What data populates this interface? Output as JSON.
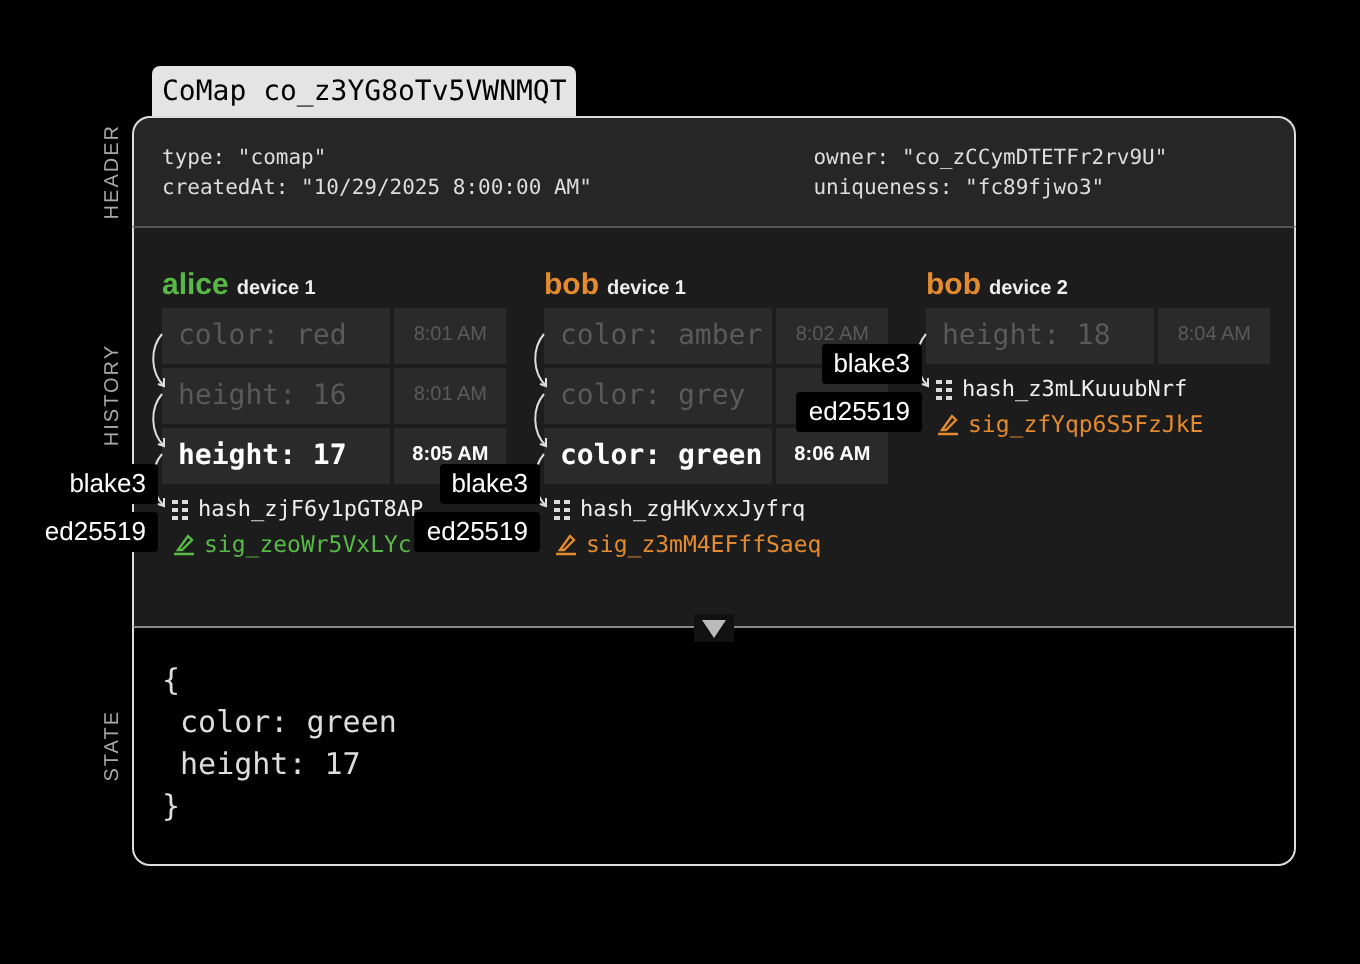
{
  "title": "CoMap co_z3YG8oTv5VWNMQT",
  "header": {
    "label": "HEADER",
    "left": [
      "type: \"comap\"",
      "createdAt: \"10/29/2025 8:00:00 AM\""
    ],
    "right": [
      "owner: \"co_zCCymDTETFr2rv9U\"",
      "uniqueness: \"fc89fjwo3\""
    ]
  },
  "history": {
    "label": "HISTORY",
    "columns": [
      {
        "user": "alice",
        "device": "device 1",
        "color": "#58b947",
        "entries": [
          {
            "text": "color: red",
            "time": "8:01 AM",
            "current": false
          },
          {
            "text": "height: 16",
            "time": "8:01 AM",
            "current": false
          },
          {
            "text": "height: 17",
            "time": "8:05 AM",
            "current": true
          }
        ],
        "hash": "hash_zjF6y1pGT8AP",
        "signature": "sig_zeoWr5VxLYc",
        "hash_algo": "blake3",
        "sig_algo": "ed25519"
      },
      {
        "user": "bob",
        "device": "device 1",
        "color": "#e48a2f",
        "entries": [
          {
            "text": "color: amber",
            "time": "8:02 AM",
            "current": false
          },
          {
            "text": "color: grey",
            "current": false
          },
          {
            "text": "color: green",
            "time": "8:06 AM",
            "current": true
          }
        ],
        "hash": "hash_zgHKvxxJyfrq",
        "signature": "sig_z3mM4EFffSaeq",
        "hash_algo": "blake3",
        "sig_algo": "ed25519"
      },
      {
        "user": "bob",
        "device": "device 2",
        "color": "#e48a2f",
        "entries": [
          {
            "text": "height: 18",
            "time": "8:04 AM",
            "current": false
          }
        ],
        "hash": "hash_z3mLKuuubNrf",
        "signature": "sig_zfYqp6S5FzJkE",
        "hash_algo": "blake3",
        "sig_algo": "ed25519"
      }
    ]
  },
  "state": {
    "label": "STATE",
    "lines": [
      "{",
      " color: green",
      " height: 17",
      "}"
    ]
  }
}
